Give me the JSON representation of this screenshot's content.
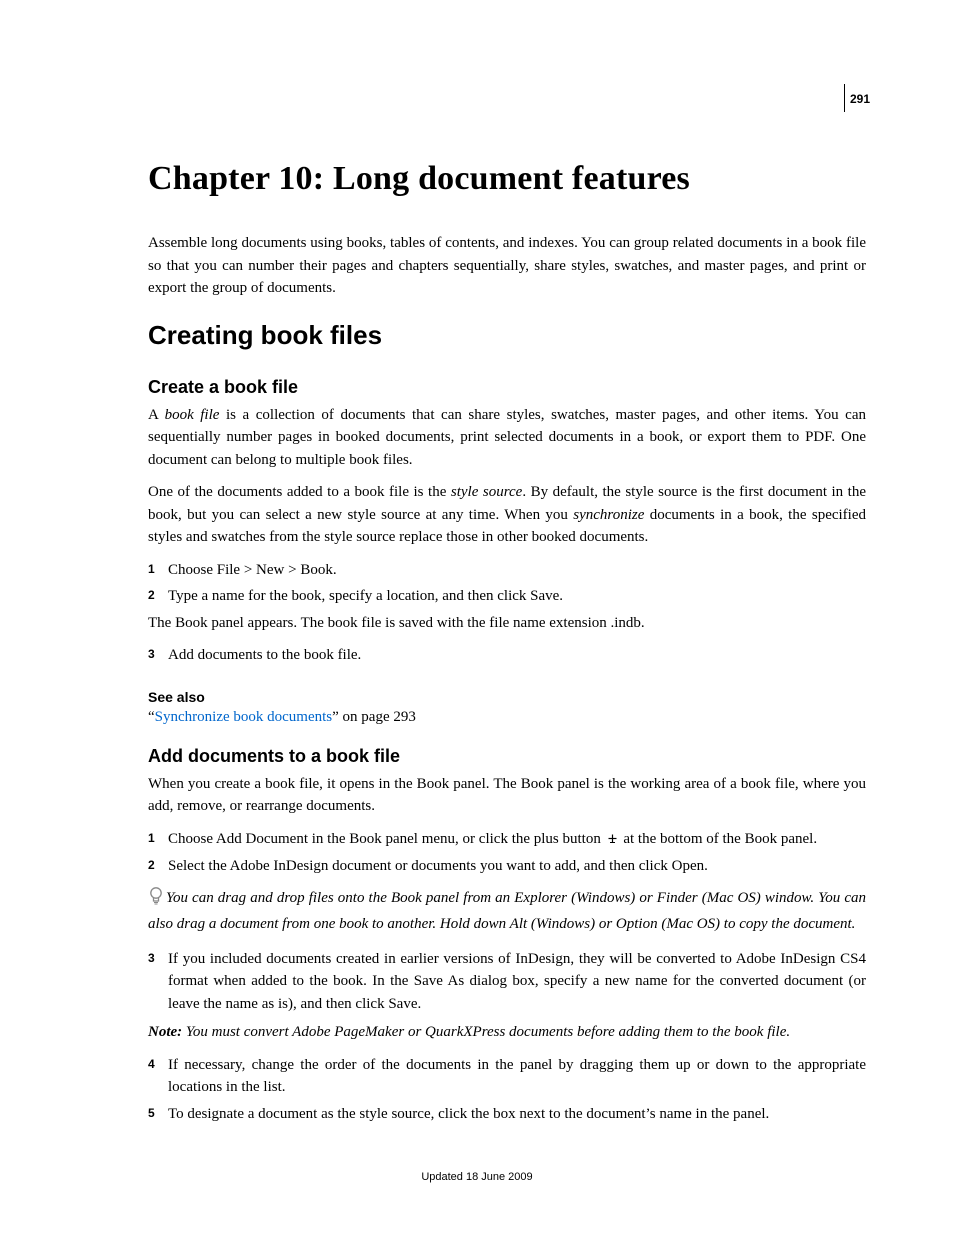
{
  "pageNumber": "291",
  "chapterTitle": "Chapter 10: Long document features",
  "intro": "Assemble long documents using books, tables of contents, and indexes. You can group related documents in a book file so that you can number their pages and chapters sequentially, share styles, swatches, and master pages, and print or export the group of documents.",
  "sectionTitle": "Creating book files",
  "sub1": {
    "title": "Create a book file",
    "p1a": "A ",
    "p1_em": "book file",
    "p1b": " is a collection of documents that can share styles, swatches, master pages, and other items. You can sequentially number pages in booked documents, print selected documents in a book, or export them to PDF. One document can belong to multiple book files.",
    "p2a": "One of the documents added to a book file is the ",
    "p2_em1": "style source",
    "p2b": ". By default, the style source is the first document in the book, but you can select a new style source at any time. When you ",
    "p2_em2": "synchronize",
    "p2c": " documents in a book, the specified styles and swatches from the style source replace those in other booked documents.",
    "steps12": [
      "Choose File > New > Book.",
      "Type a name for the book, specify a location, and then click Save."
    ],
    "p3": "The Book panel appears. The book file is saved with the file name extension .indb.",
    "steps3": [
      "Add documents to the book file."
    ],
    "seeAlsoTitle": "See also",
    "seeAlso_q1": "“",
    "seeAlso_link": "Synchronize book documents",
    "seeAlso_q2": "” on page 293"
  },
  "sub2": {
    "title": "Add documents to a book file",
    "p1": "When you create a book file, it opens in the Book panel. The Book panel is the working area of a book file, where you add, remove, or rearrange documents.",
    "step1a": "Choose Add Document in the Book panel menu, or click the plus button ",
    "step1b": " at the bottom of the Book panel.",
    "step2": "Select the Adobe InDesign document or documents you want to add, and then click Open.",
    "tip": "You can drag and drop files onto the Book panel from an Explorer (Windows) or Finder (Mac OS) window. You can also drag a document from one book to another. Hold down Alt (Windows) or Option (Mac OS) to copy the document.",
    "step3": "If you included documents created in earlier versions of InDesign, they will be converted to Adobe InDesign CS4 format when added to the book. In the Save As dialog box, specify a new name for the converted document (or leave the name as is), and then click Save.",
    "noteLabel": "Note:",
    "noteBody": " You must convert Adobe PageMaker or QuarkXPress documents before adding them to the book file.",
    "step4": "If necessary, change the order of the documents in the panel by dragging them up or down to the appropriate locations in the list.",
    "step5": "To designate a document as the style source, click the box next to the document’s name in the panel."
  },
  "footer": "Updated 18 June 2009"
}
